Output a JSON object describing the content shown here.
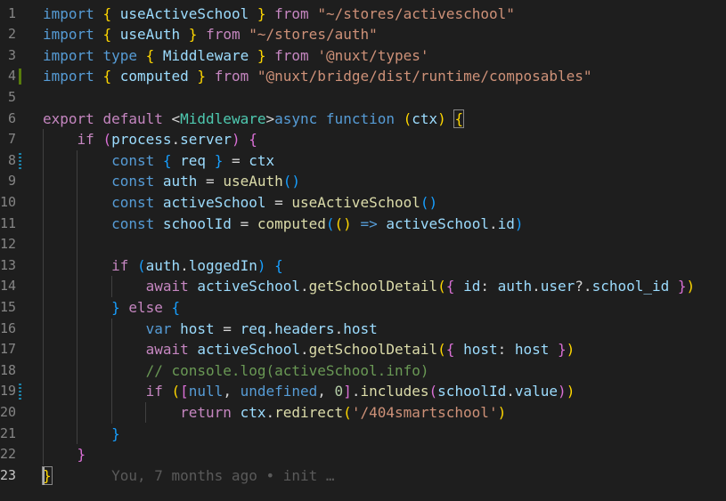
{
  "editor": {
    "lines": [
      {
        "num": "1",
        "tokens": [
          [
            "k",
            "import"
          ],
          [
            "p",
            " "
          ],
          [
            "b1",
            "{"
          ],
          [
            "p",
            " "
          ],
          [
            "v",
            "useActiveSchool"
          ],
          [
            "p",
            " "
          ],
          [
            "b1",
            "}"
          ],
          [
            "p",
            " "
          ],
          [
            "c",
            "from"
          ],
          [
            "p",
            " "
          ],
          [
            "s",
            "\"~/stores/activeschool\""
          ]
        ]
      },
      {
        "num": "2",
        "tokens": [
          [
            "k",
            "import"
          ],
          [
            "p",
            " "
          ],
          [
            "b1",
            "{"
          ],
          [
            "p",
            " "
          ],
          [
            "v",
            "useAuth"
          ],
          [
            "p",
            " "
          ],
          [
            "b1",
            "}"
          ],
          [
            "p",
            " "
          ],
          [
            "c",
            "from"
          ],
          [
            "p",
            " "
          ],
          [
            "s",
            "\"~/stores/auth\""
          ]
        ]
      },
      {
        "num": "3",
        "tokens": [
          [
            "k",
            "import"
          ],
          [
            "p",
            " "
          ],
          [
            "k",
            "type"
          ],
          [
            "p",
            " "
          ],
          [
            "b1",
            "{"
          ],
          [
            "p",
            " "
          ],
          [
            "v",
            "Middleware"
          ],
          [
            "p",
            " "
          ],
          [
            "b1",
            "}"
          ],
          [
            "p",
            " "
          ],
          [
            "c",
            "from"
          ],
          [
            "p",
            " "
          ],
          [
            "s",
            "'@nuxt/types'"
          ]
        ]
      },
      {
        "num": "4",
        "tokens": [
          [
            "k",
            "import"
          ],
          [
            "p",
            " "
          ],
          [
            "b1",
            "{"
          ],
          [
            "p",
            " "
          ],
          [
            "v",
            "computed"
          ],
          [
            "p",
            " "
          ],
          [
            "b1",
            "}"
          ],
          [
            "p",
            " "
          ],
          [
            "c",
            "from"
          ],
          [
            "p",
            " "
          ],
          [
            "s",
            "\"@nuxt/bridge/dist/runtime/composables\""
          ]
        ]
      },
      {
        "num": "5",
        "tokens": []
      },
      {
        "num": "6",
        "tokens": [
          [
            "c",
            "export"
          ],
          [
            "p",
            " "
          ],
          [
            "c",
            "default"
          ],
          [
            "p",
            " <"
          ],
          [
            "t",
            "Middleware"
          ],
          [
            "p",
            ">"
          ],
          [
            "k",
            "async"
          ],
          [
            "p",
            " "
          ],
          [
            "k",
            "function"
          ],
          [
            "p",
            " "
          ],
          [
            "b1",
            "("
          ],
          [
            "v",
            "ctx"
          ],
          [
            "b1",
            ")"
          ],
          [
            "p",
            " "
          ],
          [
            "b1",
            "{"
          ]
        ]
      },
      {
        "num": "7",
        "tokens": [
          [
            "p",
            "    "
          ],
          [
            "c",
            "if"
          ],
          [
            "p",
            " "
          ],
          [
            "b2",
            "("
          ],
          [
            "v",
            "process"
          ],
          [
            "p",
            "."
          ],
          [
            "v",
            "server"
          ],
          [
            "b2",
            ")"
          ],
          [
            "p",
            " "
          ],
          [
            "b2",
            "{"
          ]
        ]
      },
      {
        "num": "8",
        "tokens": [
          [
            "p",
            "        "
          ],
          [
            "k",
            "const"
          ],
          [
            "p",
            " "
          ],
          [
            "b3",
            "{"
          ],
          [
            "p",
            " "
          ],
          [
            "v",
            "req"
          ],
          [
            "p",
            " "
          ],
          [
            "b3",
            "}"
          ],
          [
            "p",
            " = "
          ],
          [
            "v",
            "ctx"
          ]
        ]
      },
      {
        "num": "9",
        "tokens": [
          [
            "p",
            "        "
          ],
          [
            "k",
            "const"
          ],
          [
            "p",
            " "
          ],
          [
            "v",
            "auth"
          ],
          [
            "p",
            " = "
          ],
          [
            "f",
            "useAuth"
          ],
          [
            "b3",
            "()"
          ]
        ]
      },
      {
        "num": "10",
        "tokens": [
          [
            "p",
            "        "
          ],
          [
            "k",
            "const"
          ],
          [
            "p",
            " "
          ],
          [
            "v",
            "activeSchool"
          ],
          [
            "p",
            " = "
          ],
          [
            "f",
            "useActiveSchool"
          ],
          [
            "b3",
            "()"
          ]
        ]
      },
      {
        "num": "11",
        "tokens": [
          [
            "p",
            "        "
          ],
          [
            "k",
            "const"
          ],
          [
            "p",
            " "
          ],
          [
            "v",
            "schoolId"
          ],
          [
            "p",
            " = "
          ],
          [
            "f",
            "computed"
          ],
          [
            "b3",
            "("
          ],
          [
            "b1",
            "()"
          ],
          [
            "p",
            " "
          ],
          [
            "k",
            "=>"
          ],
          [
            "p",
            " "
          ],
          [
            "v",
            "activeSchool"
          ],
          [
            "p",
            "."
          ],
          [
            "v",
            "id"
          ],
          [
            "b3",
            ")"
          ]
        ]
      },
      {
        "num": "12",
        "tokens": []
      },
      {
        "num": "13",
        "tokens": [
          [
            "p",
            "        "
          ],
          [
            "c",
            "if"
          ],
          [
            "p",
            " "
          ],
          [
            "b3",
            "("
          ],
          [
            "v",
            "auth"
          ],
          [
            "p",
            "."
          ],
          [
            "v",
            "loggedIn"
          ],
          [
            "b3",
            ")"
          ],
          [
            "p",
            " "
          ],
          [
            "b3",
            "{"
          ]
        ]
      },
      {
        "num": "14",
        "tokens": [
          [
            "p",
            "            "
          ],
          [
            "c",
            "await"
          ],
          [
            "p",
            " "
          ],
          [
            "v",
            "activeSchool"
          ],
          [
            "p",
            "."
          ],
          [
            "f",
            "getSchoolDetail"
          ],
          [
            "b1",
            "("
          ],
          [
            "b2",
            "{"
          ],
          [
            "p",
            " "
          ],
          [
            "v",
            "id"
          ],
          [
            "p",
            ": "
          ],
          [
            "v",
            "auth"
          ],
          [
            "p",
            "."
          ],
          [
            "v",
            "user"
          ],
          [
            "p",
            "?."
          ],
          [
            "v",
            "school_id"
          ],
          [
            "p",
            " "
          ],
          [
            "b2",
            "}"
          ],
          [
            "b1",
            ")"
          ]
        ]
      },
      {
        "num": "15",
        "tokens": [
          [
            "p",
            "        "
          ],
          [
            "b3",
            "}"
          ],
          [
            "p",
            " "
          ],
          [
            "c",
            "else"
          ],
          [
            "p",
            " "
          ],
          [
            "b3",
            "{"
          ]
        ]
      },
      {
        "num": "16",
        "tokens": [
          [
            "p",
            "            "
          ],
          [
            "k",
            "var"
          ],
          [
            "p",
            " "
          ],
          [
            "v",
            "host"
          ],
          [
            "p",
            " = "
          ],
          [
            "v",
            "req"
          ],
          [
            "p",
            "."
          ],
          [
            "v",
            "headers"
          ],
          [
            "p",
            "."
          ],
          [
            "v",
            "host"
          ]
        ]
      },
      {
        "num": "17",
        "tokens": [
          [
            "p",
            "            "
          ],
          [
            "c",
            "await"
          ],
          [
            "p",
            " "
          ],
          [
            "v",
            "activeSchool"
          ],
          [
            "p",
            "."
          ],
          [
            "f",
            "getSchoolDetail"
          ],
          [
            "b1",
            "("
          ],
          [
            "b2",
            "{"
          ],
          [
            "p",
            " "
          ],
          [
            "v",
            "host"
          ],
          [
            "p",
            ": "
          ],
          [
            "v",
            "host"
          ],
          [
            "p",
            " "
          ],
          [
            "b2",
            "}"
          ],
          [
            "b1",
            ")"
          ]
        ]
      },
      {
        "num": "18",
        "tokens": [
          [
            "p",
            "            "
          ],
          [
            "cm",
            "// console.log(activeSchool.info)"
          ]
        ]
      },
      {
        "num": "19",
        "tokens": [
          [
            "p",
            "            "
          ],
          [
            "c",
            "if"
          ],
          [
            "p",
            " "
          ],
          [
            "b1",
            "("
          ],
          [
            "b2",
            "["
          ],
          [
            "k",
            "null"
          ],
          [
            "p",
            ", "
          ],
          [
            "k",
            "undefined"
          ],
          [
            "p",
            ", "
          ],
          [
            "n",
            "0"
          ],
          [
            "b2",
            "]"
          ],
          [
            "p",
            "."
          ],
          [
            "f",
            "includes"
          ],
          [
            "b2",
            "("
          ],
          [
            "v",
            "schoolId"
          ],
          [
            "p",
            "."
          ],
          [
            "v",
            "value"
          ],
          [
            "b2",
            ")"
          ],
          [
            "b1",
            ")"
          ]
        ]
      },
      {
        "num": "20",
        "tokens": [
          [
            "p",
            "                "
          ],
          [
            "c",
            "return"
          ],
          [
            "p",
            " "
          ],
          [
            "v",
            "ctx"
          ],
          [
            "p",
            "."
          ],
          [
            "f",
            "redirect"
          ],
          [
            "b1",
            "("
          ],
          [
            "s",
            "'/404smartschool'"
          ],
          [
            "b1",
            ")"
          ]
        ]
      },
      {
        "num": "21",
        "tokens": [
          [
            "p",
            "        "
          ],
          [
            "b3",
            "}"
          ]
        ]
      },
      {
        "num": "22",
        "tokens": [
          [
            "p",
            "    "
          ],
          [
            "b2",
            "}"
          ]
        ]
      },
      {
        "num": "23",
        "tokens": [
          [
            "b1",
            "}"
          ]
        ],
        "blame": "       You, 7 months ago • init …"
      }
    ],
    "active_line": "23",
    "added_lines": [
      "4"
    ],
    "changed_lines": [
      "8",
      "19"
    ]
  }
}
